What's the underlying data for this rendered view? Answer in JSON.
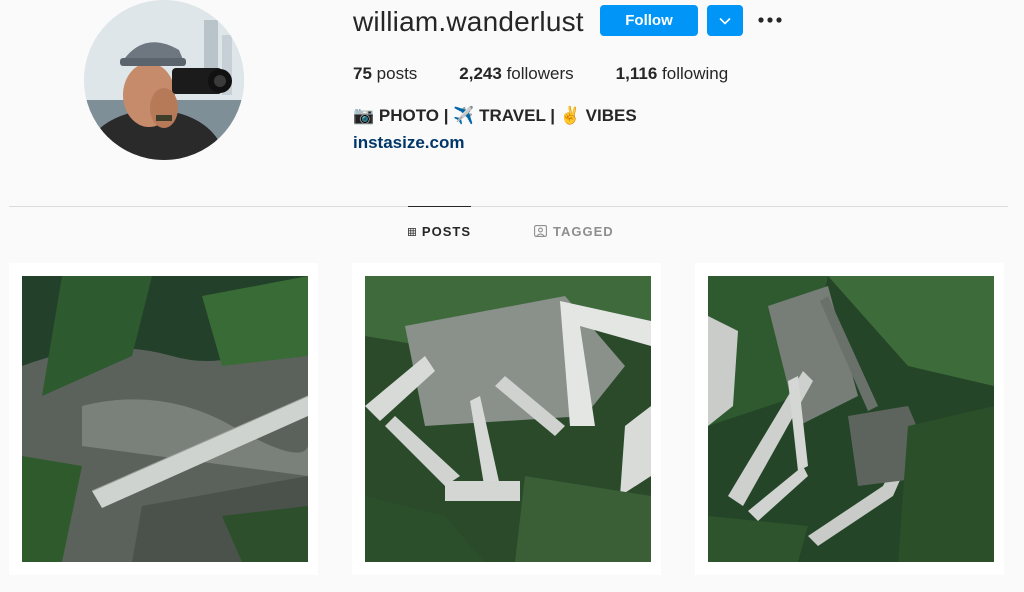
{
  "profile": {
    "username": "william.wanderlust",
    "follow_label": "Follow",
    "stats": {
      "posts_count": "75",
      "posts_label": "posts",
      "followers_count": "2,243",
      "followers_label": "followers",
      "following_count": "1,116",
      "following_label": "following"
    },
    "bio": "📷 PHOTO | ✈️ TRAVEL | ✌️ VIBES",
    "website": "instasize.com",
    "icons": {
      "dropdown": "chevron-down-icon",
      "more": "more-options-icon"
    }
  },
  "tabs": [
    {
      "label": "POSTS",
      "icon": "grid-icon",
      "active": true
    },
    {
      "label": "TAGGED",
      "icon": "tagged-icon",
      "active": false
    }
  ],
  "posts": [
    {
      "subject": "zigzag stone staircase on cliff"
    },
    {
      "subject": "switchback stairs down rock face"
    },
    {
      "subject": "winding staircase through forest"
    }
  ],
  "colors": {
    "accent": "#0095f6",
    "link": "#00376b",
    "text": "#262626",
    "muted": "#8e8e8e"
  }
}
